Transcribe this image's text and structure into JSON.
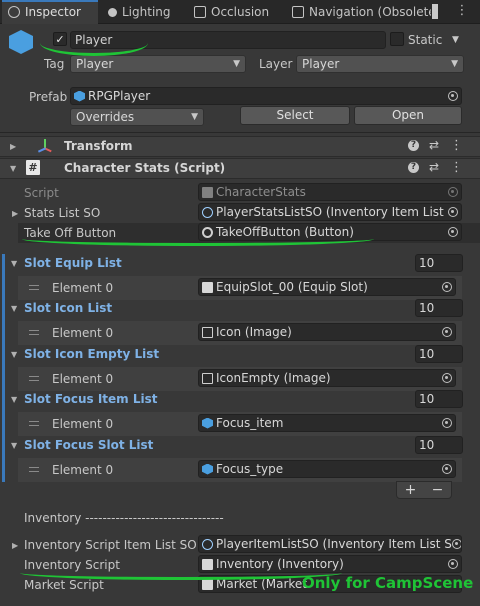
{
  "tabs": [
    {
      "label": "Inspector",
      "icon": "info-icon",
      "active": true
    },
    {
      "label": "Lighting",
      "icon": "lighting-icon",
      "active": false
    },
    {
      "label": "Occlusion",
      "icon": "occlusion-icon",
      "active": false
    },
    {
      "label": "Navigation (Obsolete",
      "icon": "navigation-icon",
      "active": false
    }
  ],
  "tab_menu": "⋮",
  "header": {
    "object_name": "Player",
    "active_checked": "✓",
    "static_label": "Static",
    "tag_label": "Tag",
    "tag_value": "Player",
    "layer_label": "Layer",
    "layer_value": "Player",
    "prefab_label": "Prefab",
    "prefab_value": "RPGPlayer",
    "overrides_label": "Overrides",
    "select_label": "Select",
    "open_label": "Open"
  },
  "transform": {
    "title": "Transform"
  },
  "character_stats": {
    "title": "Character Stats (Script)",
    "script_label": "Script",
    "script_value": "CharacterStats",
    "stats_list_label": "Stats List SO",
    "stats_list_value": "PlayerStatsListSO (Inventory Item List",
    "take_off_label": "Take Off Button",
    "take_off_value": "TakeOffButton (Button)",
    "lists": [
      {
        "label": "Slot Equip List",
        "count": "10",
        "element_label": "Element 0",
        "element_value": "EquipSlot_00 (Equip Slot)",
        "icon": "script-icon"
      },
      {
        "label": "Slot Icon List",
        "count": "10",
        "element_label": "Element 0",
        "element_value": "Icon (Image)",
        "icon": "image-icon"
      },
      {
        "label": "Slot Icon Empty List",
        "count": "10",
        "element_label": "Element 0",
        "element_value": "IconEmpty (Image)",
        "icon": "image-icon"
      },
      {
        "label": "Slot Focus Item List",
        "count": "10",
        "element_label": "Element 0",
        "element_value": "Focus_item",
        "icon": "cube-icon"
      },
      {
        "label": "Slot Focus Slot List",
        "count": "10",
        "element_label": "Element 0",
        "element_value": "Focus_type",
        "icon": "cube-icon"
      }
    ],
    "plus": "+",
    "minus": "−",
    "inventory_header": "Inventory --------------------------------",
    "inventory_item_list_label": "Inventory Script Item List SO",
    "inventory_item_list_value": "PlayerItemListSO (Inventory Item List S",
    "inventory_script_label": "Inventory Script",
    "inventory_script_value": "Inventory (Inventory)",
    "market_script_label": "Market Script",
    "market_script_value": "Market (Market"
  },
  "annotation": "Only for CampScene",
  "colors": {
    "accent": "#3a79bb",
    "annotation_green": "#1fc436",
    "list_label_blue": "#7fb2e6"
  }
}
